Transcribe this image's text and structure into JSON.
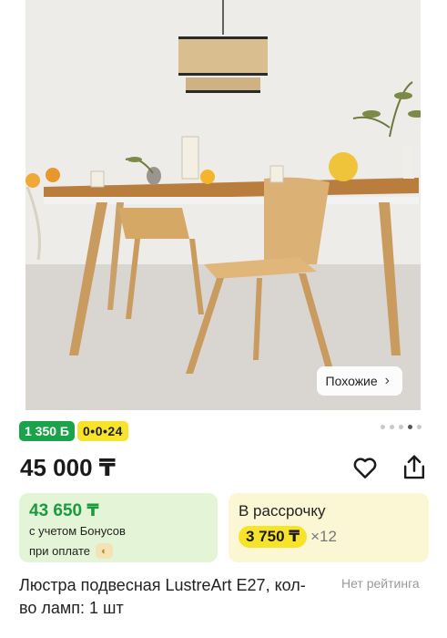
{
  "product": {
    "similar_label": "Похожие",
    "badge_bonus": "1 350 Б",
    "badge_installment": "0•0•24",
    "price": "45 000 ₸",
    "bonus_price": "43 650 ₸",
    "bonus_line1": "с учетом Бонусов",
    "bonus_line2": "при оплате",
    "installment_title": "В рассрочку",
    "installment_amount": "3 750 ₸",
    "installment_mult": "×12",
    "title": "Люстра подвесная LustreArt E27, кол-во ламп: 1 шт",
    "rating": "Нет рейтинга"
  },
  "gallery": {
    "dots_total": 5,
    "active_index": 3
  },
  "colors": {
    "accent_green": "#1aa34a",
    "accent_yellow": "#f7e32a",
    "bonus_bg": "#e3f5d6",
    "install_bg": "#fbf7d4"
  },
  "icons": [
    "chevron-right-icon",
    "heart-icon",
    "share-icon",
    "bank-logo-icon"
  ]
}
